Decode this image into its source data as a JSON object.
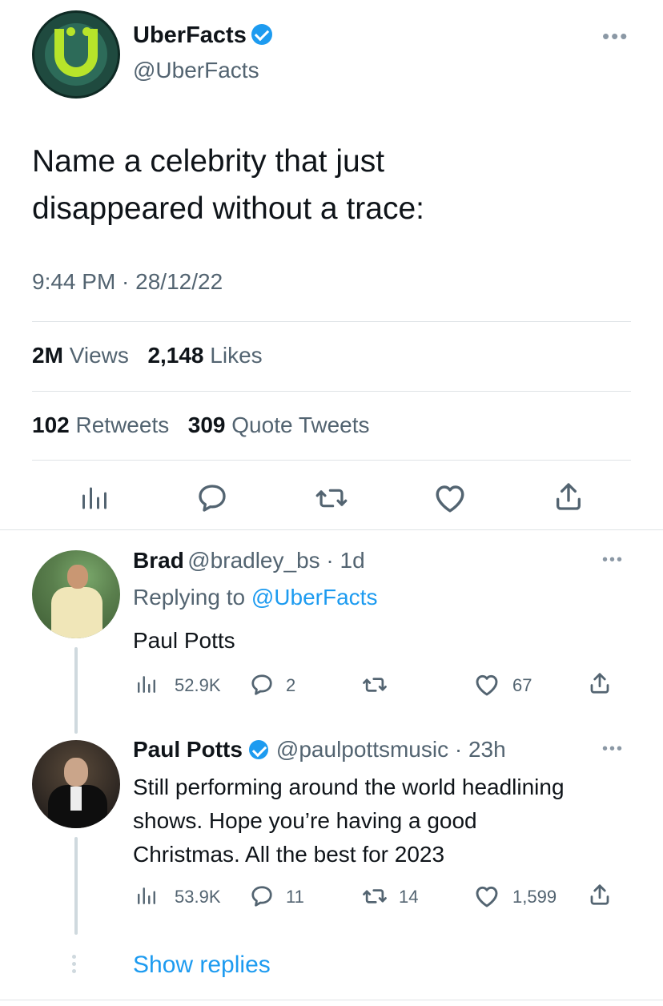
{
  "main_tweet": {
    "display_name": "UberFacts",
    "handle": "@UberFacts",
    "text_line1": "Name a celebrity that just",
    "text_line2": "disappeared without a trace:",
    "timestamp": "9:44 PM · 28/12/22",
    "views_count": "2M",
    "views_label": "Views",
    "likes_count": "2,148",
    "likes_label": "Likes",
    "retweets_count": "102",
    "retweets_label": "Retweets",
    "quotes_count": "309",
    "quotes_label": "Quote Tweets"
  },
  "replies": [
    {
      "display_name": "Brad",
      "handle_time": "@bradley_bs · 1d",
      "replying_prefix": "Replying to",
      "replying_to": "@UberFacts",
      "text": "Paul Potts",
      "views": "52.9K",
      "comments": "2",
      "retweets": "",
      "likes": "67"
    },
    {
      "display_name": "Paul Potts",
      "handle_time": "@paulpottsmusic · 23h",
      "text_line1": "Still performing around the world headlining",
      "text_line2": "shows. Hope you’re having a good",
      "text_line3": "Christmas. All the best for 2023",
      "views": "53.9K",
      "comments": "11",
      "retweets": "14",
      "likes": "1,599"
    }
  ],
  "show_replies": "Show replies",
  "colors": {
    "accent": "#1d9bf0",
    "text": "#0f1419",
    "secondary": "#536471",
    "divider": "#dfe3e6"
  },
  "icons": [
    "more-icon",
    "verified-icon",
    "views-icon",
    "reply-icon",
    "retweet-icon",
    "like-icon",
    "share-icon"
  ]
}
